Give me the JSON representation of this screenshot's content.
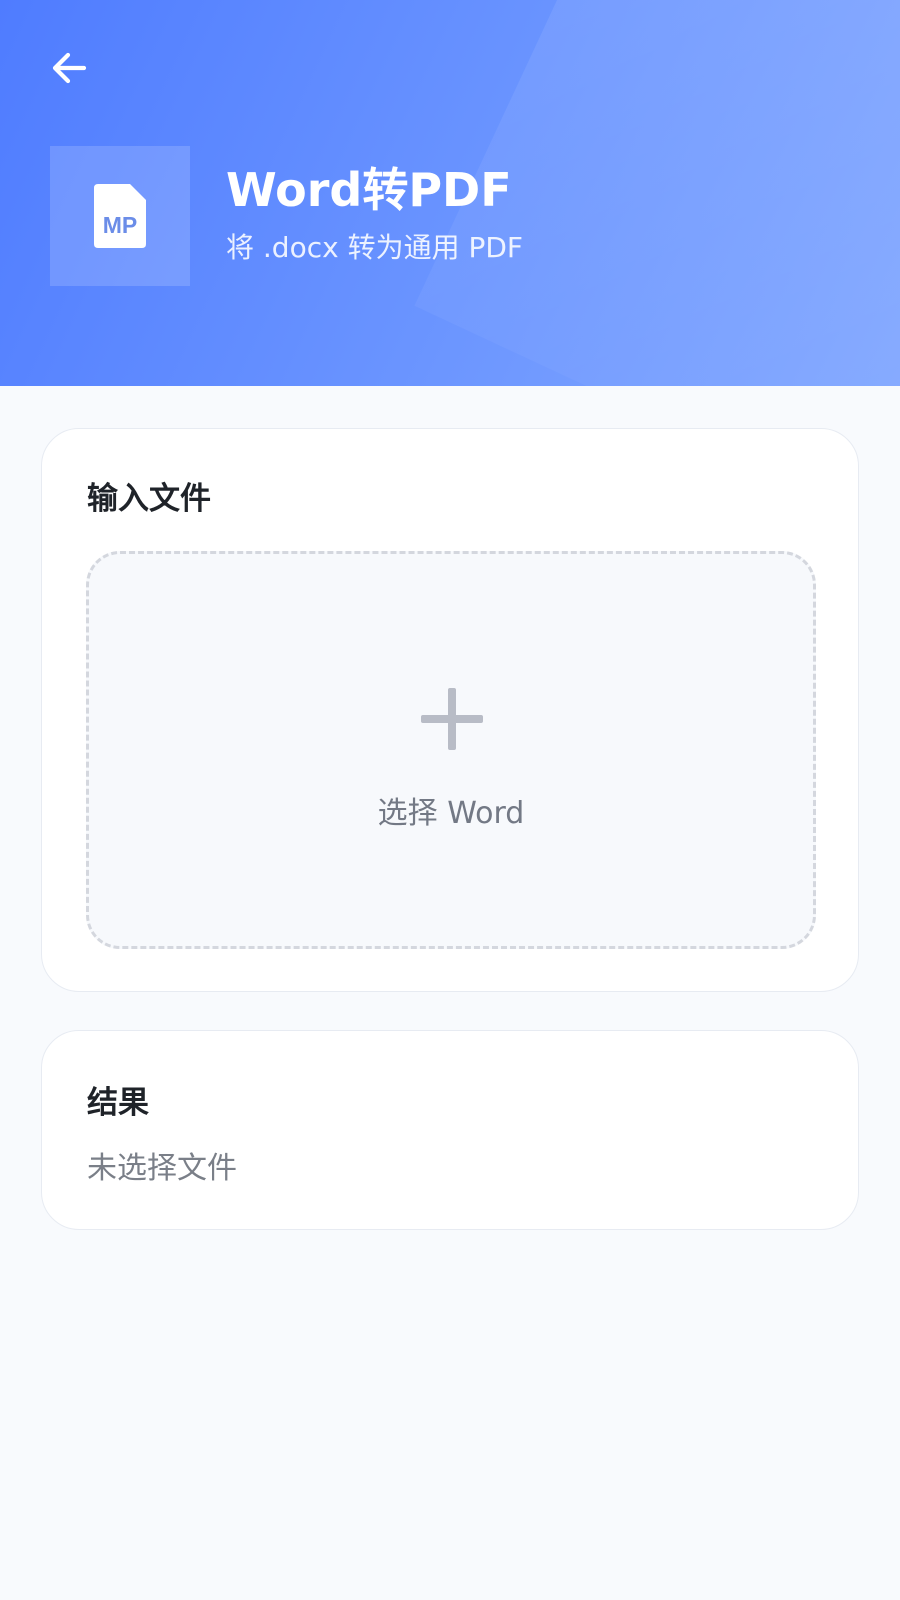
{
  "header": {
    "title": "Word转PDF",
    "subtitle": "将 .docx 转为通用 PDF",
    "back_icon": "arrow-left-icon",
    "app_icon": "mp-file-icon",
    "app_icon_text": "MP",
    "gradient_start": "#4f7cff",
    "gradient_end": "#84a9ff"
  },
  "input_card": {
    "title": "输入文件",
    "drop_zone": {
      "icon": "plus-icon",
      "label": "选择 Word"
    }
  },
  "result_card": {
    "title": "结果",
    "status": "未选择文件"
  }
}
